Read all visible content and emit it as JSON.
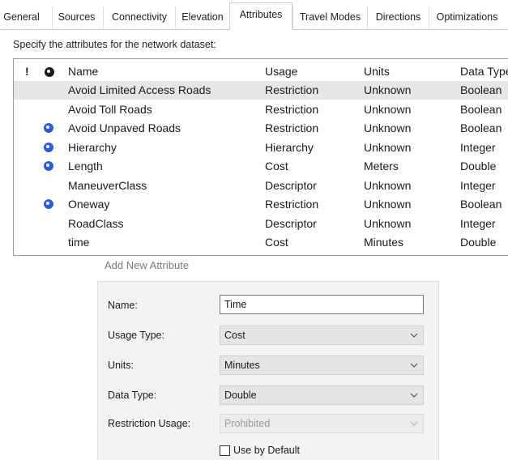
{
  "tabs": [
    {
      "label": "General"
    },
    {
      "label": "Sources"
    },
    {
      "label": "Connectivity"
    },
    {
      "label": "Elevation"
    },
    {
      "label": "Attributes",
      "active": true
    },
    {
      "label": "Travel Modes"
    },
    {
      "label": "Directions"
    },
    {
      "label": "Optimizations"
    }
  ],
  "instructions": "Specify the attributes for the network dataset:",
  "table": {
    "headers": {
      "flag": "!",
      "name": "Name",
      "usage": "Usage",
      "units": "Units",
      "data_type": "Data Type"
    },
    "rows": [
      {
        "name": "Avoid Limited Access Roads",
        "usage": "Restriction",
        "units": "Unknown",
        "data_type": "Boolean",
        "default": false,
        "selected": true
      },
      {
        "name": "Avoid Toll Roads",
        "usage": "Restriction",
        "units": "Unknown",
        "data_type": "Boolean",
        "default": false
      },
      {
        "name": "Avoid Unpaved Roads",
        "usage": "Restriction",
        "units": "Unknown",
        "data_type": "Boolean",
        "default": true
      },
      {
        "name": "Hierarchy",
        "usage": "Hierarchy",
        "units": "Unknown",
        "data_type": "Integer",
        "default": true
      },
      {
        "name": "Length",
        "usage": "Cost",
        "units": "Meters",
        "data_type": "Double",
        "default": true
      },
      {
        "name": "ManeuverClass",
        "usage": "Descriptor",
        "units": "Unknown",
        "data_type": "Integer",
        "default": false
      },
      {
        "name": "Oneway",
        "usage": "Restriction",
        "units": "Unknown",
        "data_type": "Boolean",
        "default": true
      },
      {
        "name": "RoadClass",
        "usage": "Descriptor",
        "units": "Unknown",
        "data_type": "Integer",
        "default": false
      },
      {
        "name": "time",
        "usage": "Cost",
        "units": "Minutes",
        "data_type": "Double",
        "default": false
      }
    ]
  },
  "dialog": {
    "title": "Add New Attribute",
    "name_label": "Name:",
    "name_value": "Time",
    "usage_type_label": "Usage Type:",
    "usage_type_value": "Cost",
    "units_label": "Units:",
    "units_value": "Minutes",
    "data_type_label": "Data Type:",
    "data_type_value": "Double",
    "restriction_usage_label": "Restriction Usage:",
    "restriction_usage_value": "Prohibited",
    "use_by_default_label": "Use by Default",
    "use_by_default_checked": false
  },
  "colors": {
    "default_icon": "#2f5ad9",
    "selected_row": "#e6e6e6"
  },
  "icons": {
    "default_marker": "default-attribute-icon",
    "dropdown": "chevron-down-icon"
  }
}
